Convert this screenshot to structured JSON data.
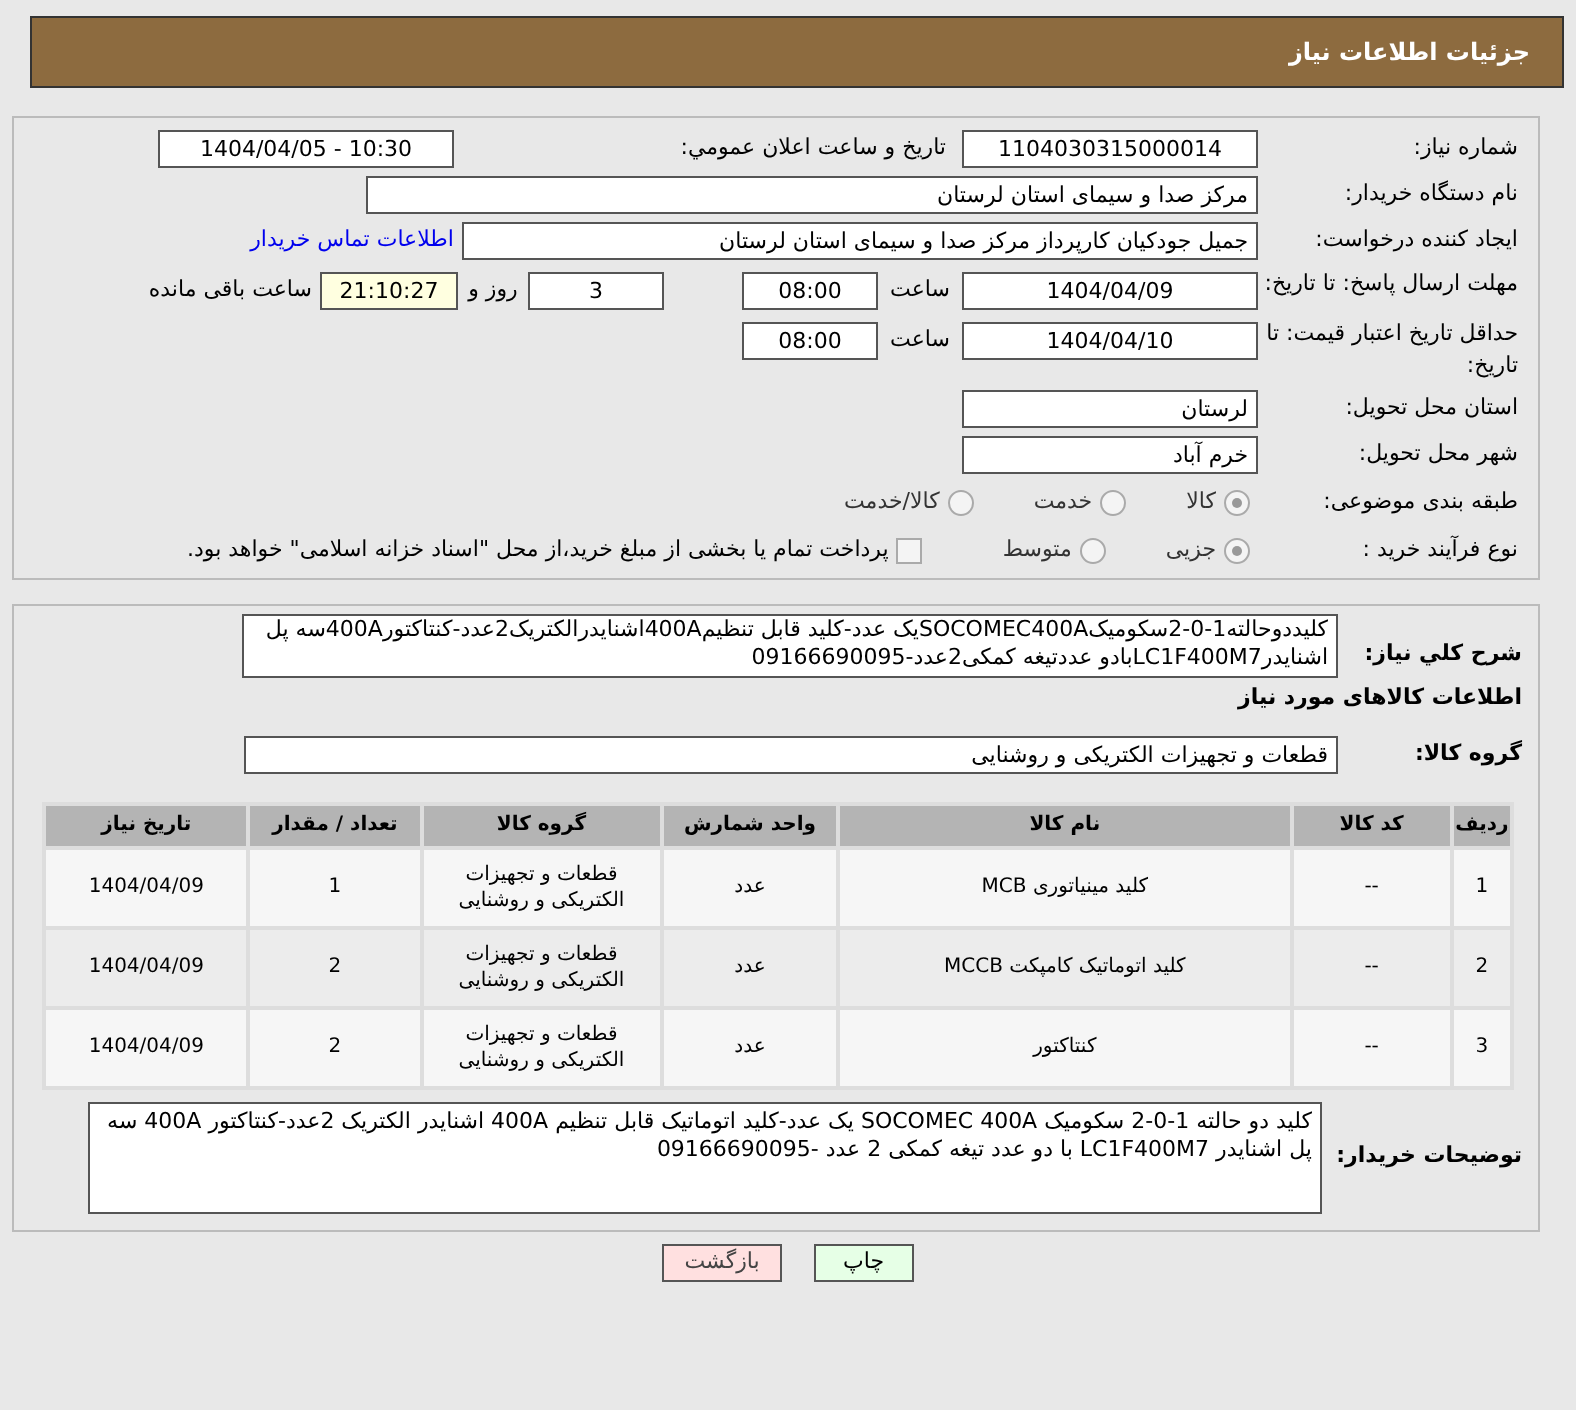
{
  "header": {
    "title": "جزئیات اطلاعات نیاز"
  },
  "form": {
    "need_number": {
      "label": "شماره نیاز:",
      "value": "1104030315000014"
    },
    "announce": {
      "label": "تاریخ و ساعت اعلان عمومي:",
      "value": "1404/04/05 - 10:30"
    },
    "buyer": {
      "label": "نام دستگاه خریدار:",
      "value": "مرکز صدا و سیمای استان لرستان"
    },
    "creator": {
      "label": "ایجاد کننده درخواست:",
      "value": "جمیل جودکیان کارپرداز مرکز صدا و سیمای استان لرستان",
      "link": "اطلاعات تماس خریدار"
    },
    "deadline": {
      "label": "مهلت ارسال پاسخ: تا تاریخ:",
      "date": "1404/04/09",
      "time_label": "ساعت",
      "time": "08:00",
      "days": "3",
      "days_label": "روز و",
      "remaining": "21:10:27",
      "remaining_label": "ساعت باقی مانده"
    },
    "validity": {
      "label": "حداقل تاریخ اعتبار قیمت: تا تاریخ:",
      "date": "1404/04/10",
      "time_label": "ساعت",
      "time": "08:00"
    },
    "province": {
      "label": "استان محل تحویل:",
      "value": "لرستان"
    },
    "city": {
      "label": "شهر محل تحویل:",
      "value": "خرم آباد"
    },
    "category": {
      "label": "طبقه بندی موضوعی:",
      "options": [
        {
          "label": "کالا",
          "selected": true
        },
        {
          "label": "خدمت",
          "selected": false
        },
        {
          "label": "کالا/خدمت",
          "selected": false
        }
      ]
    },
    "purchase": {
      "label": "نوع فرآیند خرید :",
      "options": [
        {
          "label": "جزیی",
          "selected": true
        },
        {
          "label": "متوسط",
          "selected": false
        }
      ],
      "payment": {
        "label": "پرداخت تمام یا بخشی از مبلغ خرید،از محل \"اسناد خزانه اسلامی\" خواهد بود.",
        "checked": false
      }
    }
  },
  "details": {
    "description": {
      "label": "شرح کلي نیاز:",
      "value": "کلیددوحالته1-0-2سکومیکSOCOMEC400Aیک عدد-کلید قابل تنظیم400Aاشنایدرالکتریک2عدد-کنتاکتور400Aسه پل اشنایدرLC1F400M7بادو عددتیغه کمکی2عدد-09166690095"
    },
    "goods_heading": "اطلاعات کالاهای مورد نیاز",
    "group": {
      "label": "گروه کالا:",
      "value": "قطعات و تجهیزات الکتریکی و روشنایی"
    },
    "table": {
      "columns": [
        "ردیف",
        "کد کالا",
        "نام کالا",
        "واحد شمارش",
        "گروه کالا",
        "تعداد / مقدار",
        "تاریخ نیاز"
      ],
      "rows": [
        [
          "1",
          "--",
          "کلید مینیاتوری MCB",
          "عدد",
          "قطعات و تجهیزات الکتریکی و روشنایی",
          "1",
          "1404/04/09"
        ],
        [
          "2",
          "--",
          "کلید اتوماتیک کامپکت MCCB",
          "عدد",
          "قطعات و تجهیزات الکتریکی و روشنایی",
          "2",
          "1404/04/09"
        ],
        [
          "3",
          "--",
          "کنتاکتور",
          "عدد",
          "قطعات و تجهیزات الکتریکی و روشنایی",
          "2",
          "1404/04/09"
        ]
      ]
    },
    "notes": {
      "label": "توضیحات خریدار:",
      "value": "کلید دو حالته 1-0-2 سکومیک SOCOMEC 400A یک عدد-کلید اتوماتیک قابل تنظیم 400A اشنایدر الکتریک 2عدد-کنتاکتور 400A سه پل اشنایدر LC1F400M7 با دو عدد تیغه کمکی 2 عدد -09166690095"
    }
  },
  "buttons": [
    {
      "kind": "print",
      "label": "چاپ"
    },
    {
      "kind": "back",
      "label": "بازگشت"
    }
  ]
}
